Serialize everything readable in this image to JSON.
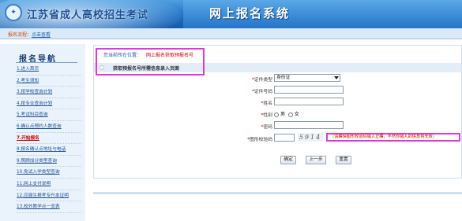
{
  "header": {
    "site_title": "江苏省成人高校招生考试",
    "system_title": "网上报名系统",
    "logo_glyph": "✦"
  },
  "navbar": {
    "crumb_label": "报名流程：",
    "crumb_link": "点击查看"
  },
  "sidebar": {
    "title": "报名导航",
    "items": [
      {
        "label": "1.进入首页"
      },
      {
        "label": "2.考生须知"
      },
      {
        "label": "3.按学校查询计划"
      },
      {
        "label": "4.按专业查询计划"
      },
      {
        "label": "5.考试科目查询"
      },
      {
        "label": "6.确认点预约人数查询"
      },
      {
        "label": "7.开始报名"
      },
      {
        "label": "8.报名确认点地址与电话"
      },
      {
        "label": "9.照顾加分类型查询"
      },
      {
        "label": "10.免试入学类型查询"
      },
      {
        "label": "11.网上支付说明"
      },
      {
        "label": "12.应届生报考专升本证明"
      },
      {
        "label": "13.校外教学点一览表"
      }
    ],
    "active_index": 6
  },
  "main": {
    "location_label": "您当前所在位置：",
    "location_value": "网上报名获取预报名号",
    "section_title": "获取预报名号所需信息录入页面",
    "form": {
      "id_type_label": "证件类型",
      "id_type_value": "身份证",
      "id_number_label": "证件号码",
      "name_label": "姓名",
      "gender_label": "性别",
      "gender_male": "男",
      "gender_female": "女",
      "password_label": "密码",
      "captcha_label": "图形校验码",
      "captcha_text": "5914",
      "captcha_notice": "（请确保图形校验码输入正确，不然你输入的信息将无效）",
      "required_mark": "*"
    },
    "buttons": {
      "confirm": "确定",
      "previous": "上一步",
      "reset": "重置"
    }
  },
  "colors": {
    "header_blue": "#1f6fc4",
    "highlight_magenta": "#e03ad2",
    "required_red": "#d00000",
    "link_blue": "#1a5cb0"
  }
}
